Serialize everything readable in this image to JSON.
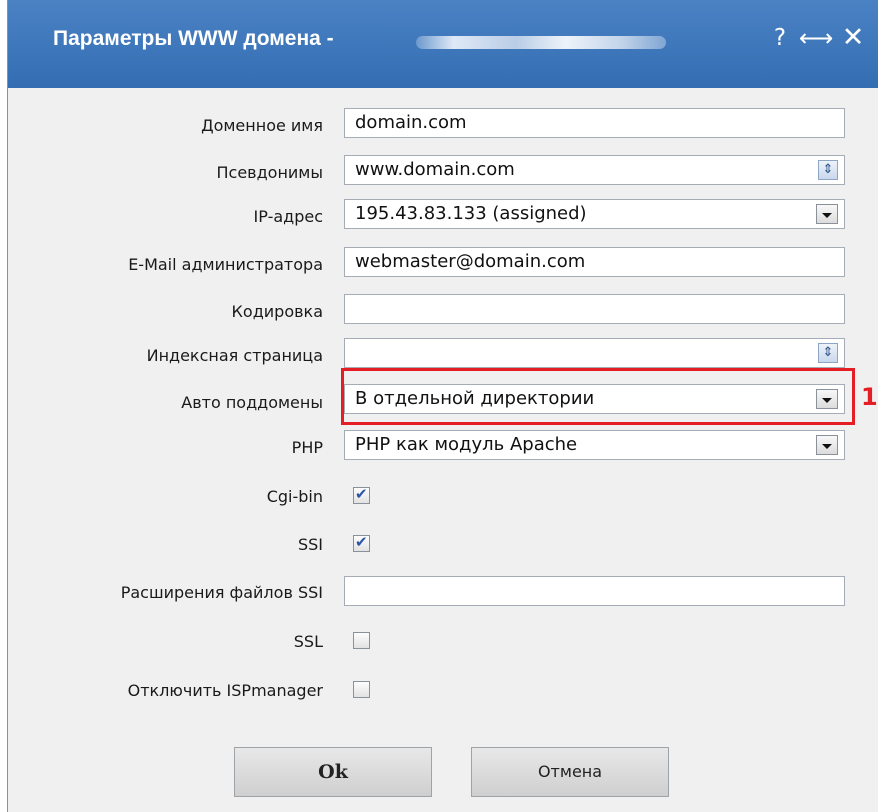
{
  "dialog": {
    "title": "Параметры WWW домена -",
    "help_glyph": "?",
    "maximize_glyph": "⟷",
    "close_glyph": "✕"
  },
  "form": {
    "domain_name": {
      "label": "Доменное имя",
      "value": "domain.com"
    },
    "aliases": {
      "label": "Псевдонимы",
      "value": "www.domain.com"
    },
    "ip_address": {
      "label": "IP-адрес",
      "value": "195.43.83.133 (assigned)"
    },
    "admin_email": {
      "label": "E-Mail администратора",
      "value": "webmaster@domain.com"
    },
    "encoding": {
      "label": "Кодировка",
      "value": ""
    },
    "index_page": {
      "label": "Индексная страница",
      "value": ""
    },
    "auto_subdomains": {
      "label": "Авто поддомены",
      "value": "В отдельной директории"
    },
    "php": {
      "label": "PHP",
      "value": "PHP как модуль Apache"
    },
    "cgi_bin": {
      "label": "Cgi-bin",
      "checked": true
    },
    "ssi": {
      "label": "SSI",
      "checked": true
    },
    "ssi_extensions": {
      "label": "Расширения файлов SSI",
      "value": ""
    },
    "ssl": {
      "label": "SSL",
      "checked": false
    },
    "disable_ispmanager": {
      "label": "Отключить ISPmanager",
      "checked": false
    }
  },
  "annotation": {
    "label": "1",
    "color": "#e51d24"
  },
  "buttons": {
    "ok": "Ok",
    "cancel": "Отмена"
  },
  "colors": {
    "titlebar": "#3f78bd",
    "background": "#f0f0f0"
  }
}
